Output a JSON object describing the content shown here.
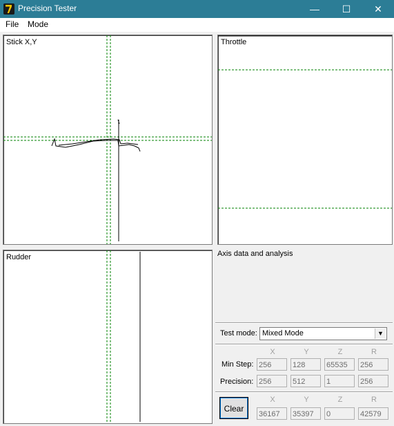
{
  "window": {
    "title": "Precision Tester"
  },
  "menu": {
    "file": "File",
    "mode": "Mode"
  },
  "panels": {
    "stick": "Stick X,Y",
    "throttle": "Throttle",
    "rudder": "Rudder"
  },
  "analysis": {
    "caption": "Axis data and analysis"
  },
  "test_mode": {
    "label": "Test mode:",
    "value": "Mixed Mode"
  },
  "stats": {
    "headers": [
      "X",
      "Y",
      "Z",
      "R"
    ],
    "min_step": {
      "label": "Min Step:",
      "values": [
        "256",
        "128",
        "65535",
        "256"
      ]
    },
    "precision": {
      "label": "Precision:",
      "values": [
        "256",
        "512",
        "1",
        "256"
      ]
    }
  },
  "readout": {
    "clear_label": "Clear",
    "headers": [
      "X",
      "Y",
      "Z",
      "R"
    ],
    "values": [
      "36167",
      "35397",
      "0",
      "42579"
    ]
  },
  "colors": {
    "titlebar": "#2c7d96",
    "guide_line": "#008000",
    "trace": "#000000"
  },
  "icons": {
    "app": "precision-tester-app-icon",
    "minimize": "minimize-icon",
    "maximize": "maximize-icon",
    "close": "close-icon",
    "dropdown": "chevron-down-icon"
  }
}
